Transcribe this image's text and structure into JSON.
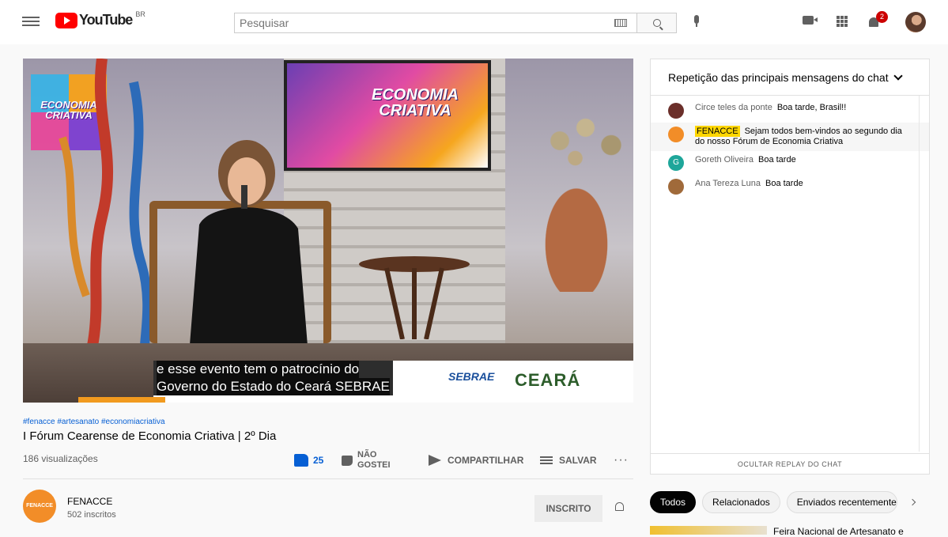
{
  "header": {
    "logo_text": "YouTube",
    "country": "BR",
    "search_placeholder": "Pesquisar",
    "notification_count": "2"
  },
  "video": {
    "caption_line1": "e esse evento tem o patrocínio do",
    "caption_line2": "Governo do Estado do Ceará SEBRAE",
    "logo_text": "ECONOMIA CRIATIVA",
    "tv_text": "ECONOMIA CRIATIVA",
    "sponsor1": "SEBRAE",
    "sponsor2": "CEARÁ",
    "hashtags": "#fenacce #artesanato #economiacriativa",
    "title": "I Fórum Cearense de Economia Criativa | 2º Dia",
    "views": "186 visualizações",
    "likes": "25",
    "dislike_label": "NÃO GOSTEI",
    "share_label": "COMPARTILHAR",
    "save_label": "SALVAR",
    "more": "···"
  },
  "channel": {
    "avatar_text": "FENACCE",
    "name": "FENACCE",
    "subs": "502 inscritos",
    "subscribe_label": "INSCRITO"
  },
  "chat": {
    "header": "Repetição das principais mensagens do chat",
    "messages": [
      {
        "author": "Circe teles da ponte",
        "text": "Boa tarde, Brasil!!",
        "avatar_color": "#6b2f2a",
        "initial": ""
      },
      {
        "author": "FENACCE",
        "text": "Sejam todos bem-vindos ao segundo dia do nosso Fórum de Economia Criativa",
        "avatar_color": "#f28d28",
        "initial": ""
      },
      {
        "author": "Goreth Oliveira",
        "text": "Boa tarde",
        "avatar_color": "#1ea69a",
        "initial": "G"
      },
      {
        "author": "Ana Tereza Luna",
        "text": "Boa tarde",
        "avatar_color": "#a06a3a",
        "initial": ""
      }
    ],
    "footer": "OCULTAR REPLAY DO CHAT"
  },
  "chips": [
    "Todos",
    "Relacionados",
    "Enviados recentemente"
  ],
  "recommend": {
    "title": "Feira Nacional de Artesanato e"
  }
}
